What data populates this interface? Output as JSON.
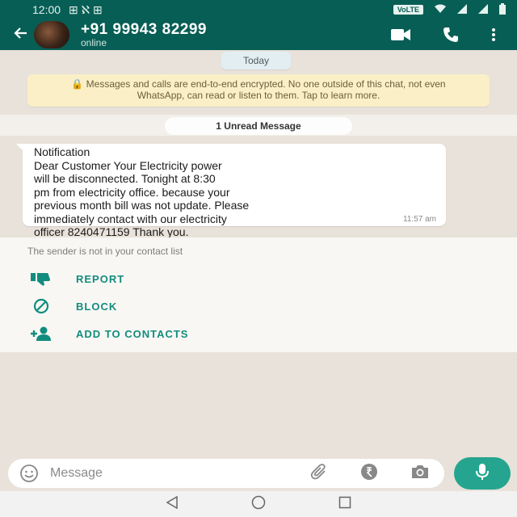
{
  "status_bar": {
    "time": "12:00",
    "indicators": "⊞ ℵ ⊞",
    "volte_label": "VoLTE",
    "icons": [
      "wifi-icon",
      "signal-icon",
      "battery-icon"
    ]
  },
  "header": {
    "contact_name": "+91 99943 82299",
    "contact_status": "online",
    "icons": [
      "back-arrow-icon",
      "avatar",
      "video-call-icon",
      "voice-call-icon",
      "more-options-icon"
    ]
  },
  "chat": {
    "date_chip": "Today",
    "encryption_notice": "🔒 Messages and calls are end-to-end encrypted. No one outside of this chat, not even WhatsApp, can read or listen to them. Tap to learn more.",
    "unread_label": "1 Unread Message",
    "message": {
      "text": "Notification\nDear Customer Your Electricity power\nwill be disconnected. Tonight at 8:30\npm from electricity office. because your\nprevious month bill was not update. Please\nimmediately contact with our electricity\nofficer 8240471159 Thank you.",
      "time": "11:57 am"
    }
  },
  "sender_panel": {
    "note": "The sender is not in your contact list",
    "actions": [
      {
        "label": "REPORT",
        "icon": "thumbs-down-icon"
      },
      {
        "label": "BLOCK",
        "icon": "block-icon"
      },
      {
        "label": "ADD TO CONTACTS",
        "icon": "add-contact-icon"
      }
    ]
  },
  "composer": {
    "placeholder": "Message",
    "icons": [
      "emoji-icon",
      "attach-icon",
      "payment-icon",
      "camera-icon",
      "mic-icon"
    ]
  },
  "nav_bar": {
    "icons": [
      "back-triangle-icon",
      "home-circle-icon",
      "recents-square-icon"
    ]
  },
  "colors": {
    "header_green": "#075e54",
    "accent_teal": "#128c7e",
    "mic_green": "#25a58f",
    "chat_background": "#e8e2da",
    "encryption_yellow": "#fbefc7"
  }
}
